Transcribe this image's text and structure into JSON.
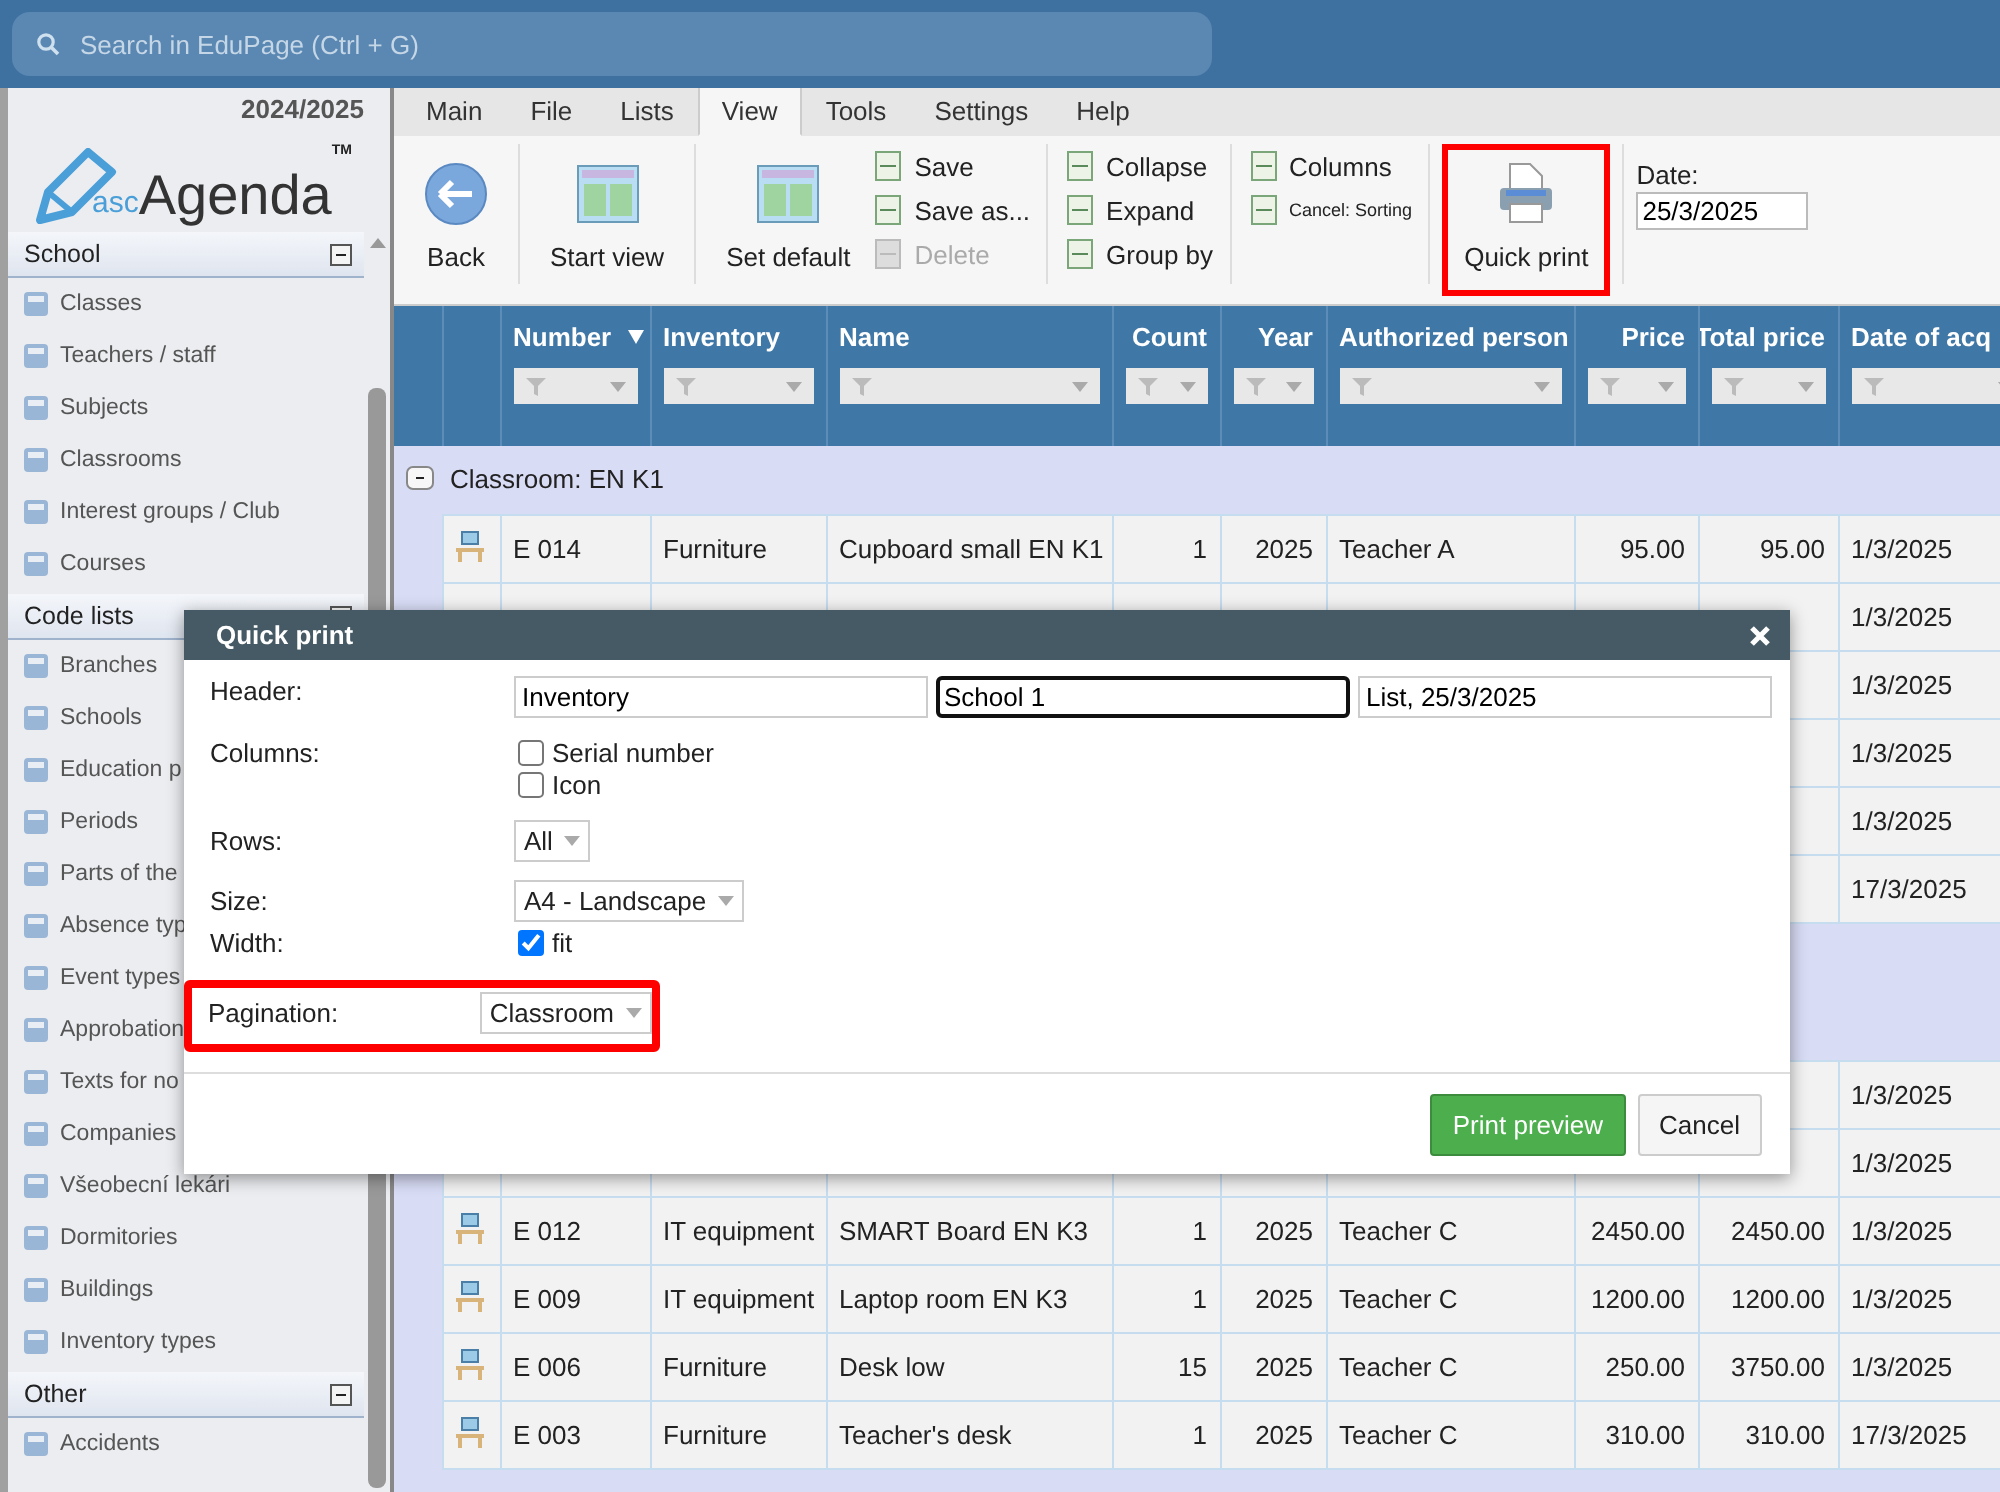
{
  "search": {
    "placeholder": "Search in EduPage (Ctrl + G)"
  },
  "sidebar": {
    "year": "2024/2025",
    "logo": {
      "prefix": "asc",
      "name": "Agenda",
      "mark": "TM"
    },
    "sections": [
      {
        "title": "School",
        "expanded": true,
        "items": [
          "Classes",
          "Teachers / staff",
          "Subjects",
          "Classrooms",
          "Interest groups / Club",
          "Courses"
        ]
      },
      {
        "title": "Code lists",
        "expanded": true,
        "items": [
          "Branches",
          "Schools",
          "Education p",
          "Periods",
          "Parts of the",
          "Absence typ",
          "Event types",
          "Approbation",
          "Texts for no",
          "Companies",
          "Všeobecní lekári",
          "Dormitories",
          "Buildings",
          "Inventory types"
        ]
      },
      {
        "title": "Other",
        "expanded": true,
        "items": [
          "Accidents"
        ]
      }
    ]
  },
  "menu": [
    {
      "label": "Main",
      "selected": false
    },
    {
      "label": "File",
      "selected": false
    },
    {
      "label": "Lists",
      "selected": false
    },
    {
      "label": "View",
      "selected": true
    },
    {
      "label": "Tools",
      "selected": false
    },
    {
      "label": "Settings",
      "selected": false
    },
    {
      "label": "Help",
      "selected": false
    }
  ],
  "toolbar": {
    "groups": [
      {
        "buttons": [
          {
            "kind": "back",
            "label": "Back",
            "disabled": false,
            "highlighted": false
          }
        ]
      },
      {
        "buttons": [
          {
            "kind": "layout",
            "label": "Start view",
            "disabled": false,
            "highlighted": false
          }
        ]
      },
      {
        "buttons": [
          {
            "kind": "layout",
            "label": "Set default",
            "disabled": false,
            "highlighted": false
          },
          {
            "kind": "small",
            "label": "Save",
            "disabled": false,
            "highlighted": false
          },
          {
            "kind": "small",
            "label": "Save as...",
            "disabled": false,
            "highlighted": false
          },
          {
            "kind": "small",
            "label": "Delete",
            "disabled": true,
            "highlighted": false
          }
        ]
      },
      {
        "buttons": [
          {
            "kind": "small",
            "label": "Collapse",
            "disabled": false,
            "highlighted": false
          },
          {
            "kind": "small",
            "label": "Expand",
            "disabled": false,
            "highlighted": false
          },
          {
            "kind": "small",
            "label": "Group by",
            "disabled": false,
            "highlighted": false
          }
        ]
      },
      {
        "buttons": [
          {
            "kind": "small",
            "label": "Columns",
            "disabled": false,
            "highlighted": false
          },
          {
            "kind": "note",
            "label": "Cancel: Sorting",
            "disabled": false,
            "highlighted": false
          }
        ]
      },
      {
        "buttons": [
          {
            "kind": "print",
            "label": "Quick print",
            "disabled": false,
            "highlighted": true
          }
        ]
      }
    ],
    "date": {
      "label": "Date:",
      "value": "25/3/2025"
    }
  },
  "table": {
    "columns": [
      {
        "label": "Number",
        "sorted": true
      },
      {
        "label": "Inventory",
        "sorted": false
      },
      {
        "label": "Name",
        "sorted": false
      },
      {
        "label": "Count",
        "sorted": false
      },
      {
        "label": "Year",
        "sorted": false
      },
      {
        "label": "Authorized person",
        "sorted": false
      },
      {
        "label": "Price",
        "sorted": false
      },
      {
        "label": "Total price",
        "sorted": false
      },
      {
        "label": "Date of acq",
        "sorted": false
      }
    ],
    "rows": [
      {
        "kind": "group",
        "label": "Classroom: EN K1",
        "expanded": true
      },
      {
        "kind": "item",
        "cells": [
          "E 014",
          "Furniture",
          "Cupboard small EN K1",
          "1",
          "2025",
          "Teacher A",
          "95.00",
          "95.00",
          "1/3/2025"
        ]
      },
      {
        "kind": "item",
        "cells": [
          null,
          null,
          null,
          null,
          null,
          null,
          null,
          null,
          "1/3/2025"
        ]
      },
      {
        "kind": "item",
        "cells": [
          null,
          null,
          null,
          null,
          null,
          null,
          null,
          null,
          "1/3/2025"
        ]
      },
      {
        "kind": "item",
        "cells": [
          null,
          null,
          null,
          null,
          null,
          null,
          null,
          null,
          "1/3/2025"
        ]
      },
      {
        "kind": "item",
        "cells": [
          null,
          null,
          null,
          null,
          null,
          null,
          null,
          null,
          "1/3/2025"
        ]
      },
      {
        "kind": "item",
        "cells": [
          null,
          null,
          null,
          null,
          null,
          null,
          null,
          null,
          "17/3/2025"
        ]
      },
      {
        "kind": "group"
      },
      {
        "kind": "group"
      },
      {
        "kind": "item",
        "cells": [
          null,
          null,
          null,
          null,
          null,
          null,
          null,
          null,
          "1/3/2025"
        ]
      },
      {
        "kind": "item",
        "cells": [
          null,
          null,
          null,
          null,
          null,
          null,
          null,
          null,
          "1/3/2025"
        ]
      },
      {
        "kind": "item",
        "cells": [
          "E 012",
          "IT equipment",
          "SMART Board EN K3",
          "1",
          "2025",
          "Teacher C",
          "2450.00",
          "2450.00",
          "1/3/2025"
        ]
      },
      {
        "kind": "item",
        "cells": [
          "E 009",
          "IT equipment",
          "Laptop room EN K3",
          "1",
          "2025",
          "Teacher C",
          "1200.00",
          "1200.00",
          "1/3/2025"
        ]
      },
      {
        "kind": "item",
        "cells": [
          "E 006",
          "Furniture",
          "Desk low",
          "15",
          "2025",
          "Teacher C",
          "250.00",
          "3750.00",
          "1/3/2025"
        ]
      },
      {
        "kind": "item",
        "cells": [
          "E 003",
          "Furniture",
          "Teacher's desk",
          "1",
          "2025",
          "Teacher C",
          "310.00",
          "310.00",
          "17/3/2025"
        ]
      },
      {
        "kind": "group"
      }
    ]
  },
  "dialog": {
    "title": "Quick print",
    "header": {
      "label": "Header:",
      "fields": [
        {
          "value": "Inventory",
          "focused": false
        },
        {
          "value": "School 1",
          "focused": true
        },
        {
          "value": "List, 25/3/2025",
          "focused": false
        }
      ]
    },
    "columns": {
      "label": "Columns:",
      "options": [
        {
          "label": "Serial number",
          "checked": false
        },
        {
          "label": "Icon",
          "checked": false
        }
      ]
    },
    "rows": {
      "label": "Rows:",
      "value": "All"
    },
    "size": {
      "label": "Size:",
      "value": "A4 - Landscape"
    },
    "width": {
      "label": "Width:",
      "option": {
        "label": "fit",
        "checked": true
      }
    },
    "pagination": {
      "label": "Pagination:",
      "value": "Classroom",
      "highlighted": true
    },
    "buttons": [
      {
        "label": "Print preview",
        "primary": true
      },
      {
        "label": "Cancel",
        "primary": false
      }
    ]
  }
}
